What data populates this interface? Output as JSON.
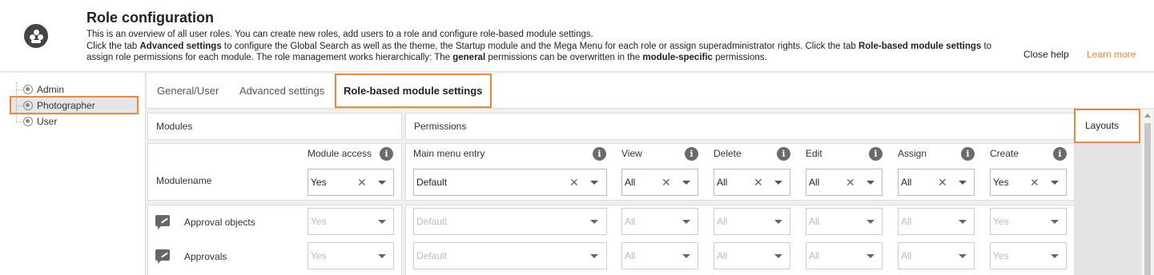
{
  "header": {
    "title": "Role configuration",
    "desc_line1": "This is an overview of all user roles. You can create new roles, add users to a role and configure role-based module settings.",
    "desc_2a": "Click the tab ",
    "desc_2b": "Advanced settings",
    "desc_2c": " to configure the Global Search as well as the theme, the Startup module and the Mega Menu for each role or assign superadministrator rights. Click the tab ",
    "desc_2d": "Role-based module settings",
    "desc_2e": " to assign role permissions for each module. The role management works hierarchically: The ",
    "desc_2f": "general",
    "desc_2g": " permissions can be overwritten in the ",
    "desc_2h": "module-specific",
    "desc_2i": " permissions.",
    "close_help": "Close help",
    "learn_more": "Learn more",
    "accent_color": "#f0883a"
  },
  "tree": {
    "roles": [
      "Admin",
      "Photographer",
      "User"
    ],
    "selected": "Photographer"
  },
  "tabs": [
    {
      "label": "General/User"
    },
    {
      "label": "Advanced settings"
    },
    {
      "label": "Role-based module settings",
      "active": true
    }
  ],
  "sections": {
    "modules": "Modules",
    "permissions": "Permissions",
    "layouts": "Layouts"
  },
  "columns": {
    "module_access": "Module access",
    "main_menu_entry": "Main menu entry",
    "view": "View",
    "delete": "Delete",
    "edit": "Edit",
    "assign": "Assign",
    "create": "Create"
  },
  "default_row": {
    "label": "Modulename",
    "module_access": "Yes",
    "main_menu_entry": "Default",
    "view": "All",
    "delete": "All",
    "edit": "All",
    "assign": "All",
    "create": "Yes"
  },
  "modules": [
    {
      "name": "Approval objects",
      "module_access": "Yes",
      "main_menu_entry": "Default",
      "view": "All",
      "delete": "All",
      "edit": "All",
      "assign": "All",
      "create": "Yes"
    },
    {
      "name": "Approvals",
      "module_access": "Yes",
      "main_menu_entry": "Default",
      "view": "All",
      "delete": "All",
      "edit": "All",
      "assign": "All",
      "create": "Yes"
    }
  ],
  "icons": {
    "logo": "users-icon",
    "role": "role-icon",
    "info": "info-icon",
    "clear": "clear-icon",
    "dropdown": "chevron-down-icon",
    "module": "edit-comment-icon"
  }
}
